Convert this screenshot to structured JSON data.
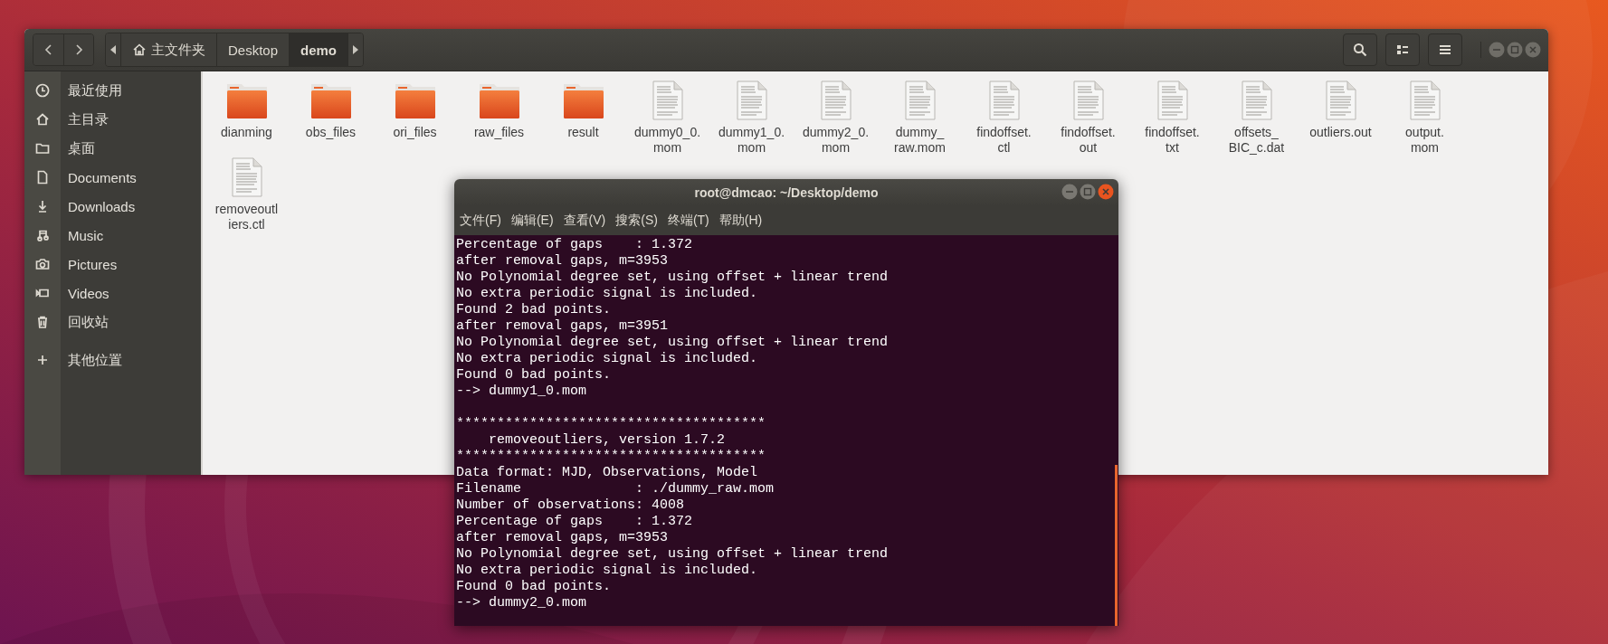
{
  "file_manager": {
    "path_bar": [
      {
        "label": "主文件夹",
        "kind": "home",
        "selected": false
      },
      {
        "label": "Desktop",
        "kind": "folder",
        "selected": false
      },
      {
        "label": "demo",
        "kind": "folder",
        "selected": true
      }
    ],
    "sidebar": {
      "items": [
        {
          "label": "最近使用",
          "selected": false
        },
        {
          "label": "主目录",
          "selected": false
        },
        {
          "label": "桌面",
          "selected": false
        },
        {
          "label": "Documents",
          "selected": false
        },
        {
          "label": "Downloads",
          "selected": false
        },
        {
          "label": "Music",
          "selected": false
        },
        {
          "label": "Pictures",
          "selected": false
        },
        {
          "label": "Videos",
          "selected": false
        },
        {
          "label": "回收站",
          "selected": false
        },
        {
          "label": "其他位置",
          "selected": false
        }
      ]
    },
    "files": [
      {
        "name": "dianming",
        "kind": "folder"
      },
      {
        "name": "obs_files",
        "kind": "folder"
      },
      {
        "name": "ori_files",
        "kind": "folder"
      },
      {
        "name": "raw_files",
        "kind": "folder"
      },
      {
        "name": "result",
        "kind": "folder"
      },
      {
        "name": "dummy0_0.\nmom",
        "kind": "document"
      },
      {
        "name": "dummy1_0.\nmom",
        "kind": "document"
      },
      {
        "name": "dummy2_0.\nmom",
        "kind": "document"
      },
      {
        "name": "dummy_\nraw.mom",
        "kind": "document"
      },
      {
        "name": "findoffset.\nctl",
        "kind": "document"
      },
      {
        "name": "findoffset.\nout",
        "kind": "document"
      },
      {
        "name": "findoffset.\ntxt",
        "kind": "document"
      },
      {
        "name": "offsets_\nBIC_c.dat",
        "kind": "document"
      },
      {
        "name": "outliers.out",
        "kind": "document"
      },
      {
        "name": "output.\nmom",
        "kind": "document"
      },
      {
        "name": "removeoutl\niers.ctl",
        "kind": "document"
      }
    ]
  },
  "terminal": {
    "title": "root@dmcao: ~/Desktop/demo",
    "menu": [
      "文件(F)",
      "编辑(E)",
      "查看(V)",
      "搜索(S)",
      "终端(T)",
      "帮助(H)"
    ],
    "output": [
      [
        "Percentage of gaps    : 1.372",
        "after removal gaps, m=3953",
        "No Polynomial degree set, using offset + linear trend",
        "No extra periodic signal is included.",
        "Found 2 bad points.",
        "after removal gaps, m=3951",
        "No Polynomial degree set, using offset + linear trend",
        "No extra periodic signal is included.",
        "Found 0 bad points.",
        "--> dummy1_0.mom"
      ],
      [
        "**************************************",
        "    removeoutliers, version 1.7.2",
        "**************************************",
        "Data format: MJD, Observations, Model",
        "Filename              : ./dummy_raw.mom",
        "Number of observations: 4008",
        "Percentage of gaps    : 1.372",
        "after removal gaps, m=3953",
        "No Polynomial degree set, using offset + linear trend",
        "No extra periodic signal is included.",
        "Found 0 bad points.",
        "--> dummy2_0.mom"
      ]
    ]
  }
}
